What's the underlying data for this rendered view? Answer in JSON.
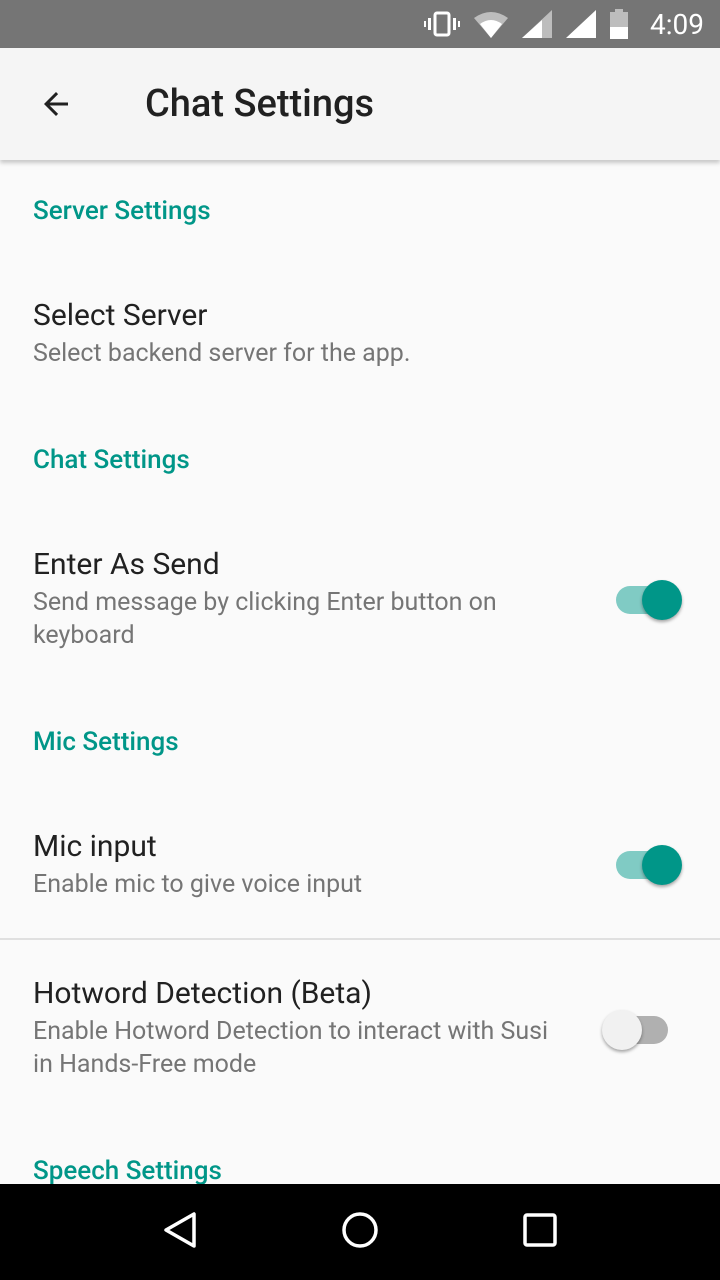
{
  "status_bar": {
    "time": "4:09",
    "icons": [
      "vibrate-icon",
      "wifi-icon",
      "signal-icon",
      "signal-icon",
      "battery-icon"
    ]
  },
  "app_bar": {
    "title": "Chat Settings",
    "back_icon": "arrow-back-icon"
  },
  "sections": [
    {
      "header": "Server Settings",
      "items": [
        {
          "title": "Select Server",
          "summary": "Select backend server for the app."
        }
      ]
    },
    {
      "header": "Chat Settings",
      "items": [
        {
          "title": "Enter As Send",
          "summary": "Send message by clicking Enter button on keyboard",
          "toggle": true
        }
      ]
    },
    {
      "header": "Mic Settings",
      "items": [
        {
          "title": "Mic input",
          "summary": "Enable mic to give voice input",
          "toggle": true
        },
        {
          "title": "Hotword Detection (Beta)",
          "summary": "Enable Hotword Detection to interact with Susi in Hands-Free mode",
          "toggle": false
        }
      ]
    },
    {
      "header": "Speech Settings"
    }
  ],
  "colors": {
    "accent": "#009688",
    "status_bar": "#757575"
  },
  "nav_bar": [
    "back-icon",
    "home-icon",
    "recents-icon"
  ]
}
